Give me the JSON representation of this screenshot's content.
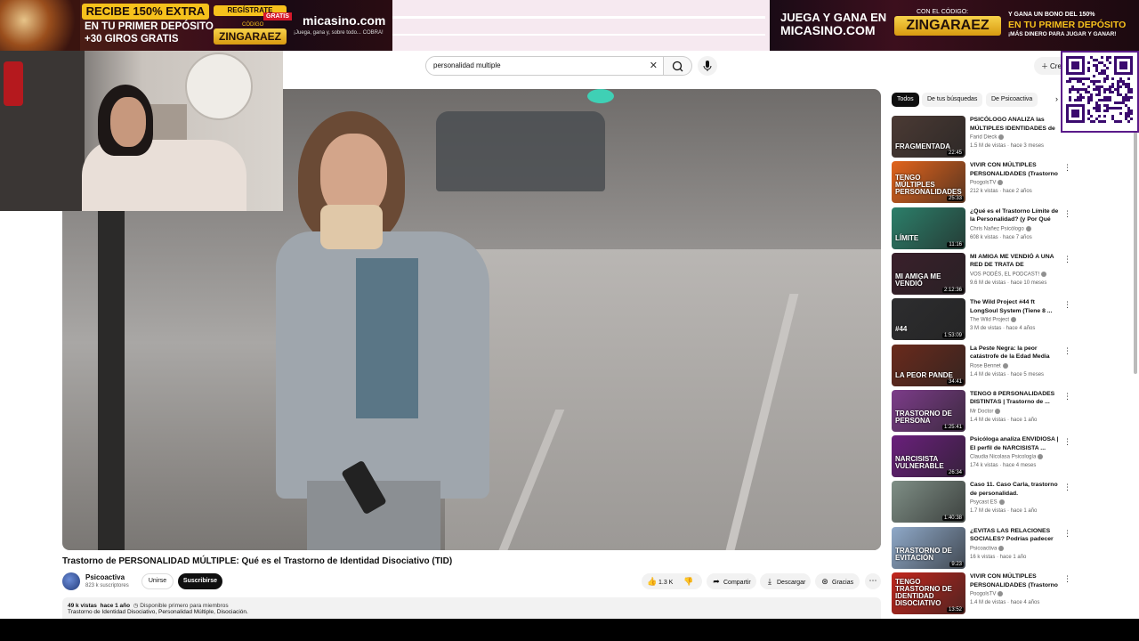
{
  "ads": {
    "left": {
      "headline": "RECIBE 150% EXTRA",
      "line2": "EN TU PRIMER DEPÓSITO",
      "line3": "+30 GIROS GRATIS",
      "register": "REGÍSTRATE",
      "free": "GRATIS",
      "code_label": "CÓDIGO",
      "code": "ZINGARAEZ",
      "brand": "micasino.com",
      "tagline": "¡Juega, gana y, sobre todo... COBRA!"
    },
    "right": {
      "line1": "JUEGA Y GANA EN",
      "line2": "MICASINO.COM",
      "code_label": "CON EL CÓDIGO:",
      "code": "ZINGARAEZ",
      "promo1": "Y GANA UN BONO DEL 150%",
      "promo2": "EN TU PRIMER DEPÓSITO",
      "promo3": "¡MÁS DINERO PARA JUGAR Y GANAR!"
    }
  },
  "search": {
    "query": "personalidad multiple",
    "clear_icon": "close-icon",
    "search_icon": "search-icon",
    "mic_icon": "mic-icon"
  },
  "header": {
    "create_label": "Cre"
  },
  "video": {
    "title": "Trastorno de PERSONALIDAD MÚLTIPLE: Qué es el Trastorno de Identidad Disociativo (TID)",
    "channel": "Psicoactiva",
    "subscribers": "823 k suscriptores",
    "join_label": "Unirse",
    "subscribe_label": "Suscribirse",
    "likes": "1.3 K",
    "share_label": "Compartir",
    "download_label": "Descargar",
    "thanks_label": "Gracias",
    "views": "49 k vistas",
    "age": "hace 1 año",
    "members_first": "Disponible primero para miembros",
    "tags": "Trastorno de Identidad Disociativo, Personalidad Múltiple, Disociación."
  },
  "chips": [
    {
      "label": "Todos"
    },
    {
      "label": "De tus búsquedas"
    },
    {
      "label": "De Psicoactiva"
    }
  ],
  "recommendations": [
    {
      "title": "PSICÓLOGO ANALIZA las MÚLTIPLES IDENTIDADES de ...",
      "channel": "Farid Dieck",
      "meta": "1.5 M de vistas · hace 3 meses",
      "duration": "22:45",
      "thumb_text": "FRAGMENTADA",
      "color": "#4b3a34"
    },
    {
      "title": "VIVIR CON MÚLTIPLES PERSONALIDADES (Trastorno ...",
      "channel": "PoogolsTV",
      "meta": "212 k vistas · hace 2 años",
      "duration": "25:33",
      "thumb_text": "TENGO MÚLTIPLES PERSONALIDADES",
      "color": "#e2641c"
    },
    {
      "title": "¿Qué es el Trastorno Límite de la Personalidad? (y Por Qué es...",
      "channel": "Chris Nañez Psicólogo",
      "meta": "608 k vistas · hace 7 años",
      "duration": "11:16",
      "thumb_text": "LÍMITE",
      "color": "#2c7f6a"
    },
    {
      "title": "MI AMIGA ME VENDIÓ A UNA RED DE TRATA DE PERSONAS ...",
      "channel": "VOS PODÉS, EL PODCAST!",
      "meta": "9.6 M de vistas · hace 10 meses",
      "duration": "2:12:36",
      "thumb_text": "MI AMIGA ME VENDIÓ",
      "color": "#3a1f2b"
    },
    {
      "title": "The Wild Project #44 ft LongSoul System (Tiene 8 ...",
      "channel": "The Wild Project",
      "meta": "3 M de vistas · hace 4 años",
      "duration": "1:53:09",
      "thumb_text": "#44",
      "color": "#2d2d2f"
    },
    {
      "title": "La Peste Negra: la peor catástrofe de la Edad Media",
      "channel": "Rose Bennet",
      "meta": "1.4 M de vistas · hace 5 meses",
      "duration": "34:41",
      "thumb_text": "LA PEOR PANDE",
      "color": "#6a2a1c"
    },
    {
      "title": "TENGO 8 PERSONALIDADES DISTINTAS | Trastorno de ...",
      "channel": "Mr Doctor",
      "meta": "1.4 M de vistas · hace 1 año",
      "duration": "1:25:41",
      "thumb_text": "TRASTORNO DE PERSONA",
      "color": "#7d3c8a"
    },
    {
      "title": "Psicóloga analiza ENVIDIOSA | El perfil de NARCISISTA ...",
      "channel": "Claudia Nicolasa Psicología",
      "meta": "174 k vistas · hace 4 meses",
      "duration": "26:34",
      "thumb_text": "NARCISISTA VULNERABLE",
      "color": "#6a1f7c"
    },
    {
      "title": "Caso 11. Caso Carla, trastorno de personalidad.",
      "channel": "Psycast ES",
      "meta": "1.7 M de vistas · hace 1 año",
      "duration": "1:40:38",
      "thumb_text": "",
      "color": "#7f8f86"
    },
    {
      "title": "¿EVITAS LAS RELACIONES SOCIALES? Podrías padecer u...",
      "channel": "Psicoactiva",
      "meta": "16 k vistas · hace 1 año",
      "duration": "9:23",
      "thumb_text": "TRASTORNO DE EVITACIÓN",
      "color": "#8fa9c9"
    },
    {
      "title": "VIVIR CON MÚLTIPLES PERSONALIDADES (Trastorno ...",
      "channel": "PoogolsTV",
      "meta": "1.4 M de vistas · hace 4 años",
      "duration": "13:52",
      "thumb_text": "TENGO TRASTORNO DE IDENTIDAD DISOCIATIVO",
      "color": "#c3261d"
    }
  ]
}
